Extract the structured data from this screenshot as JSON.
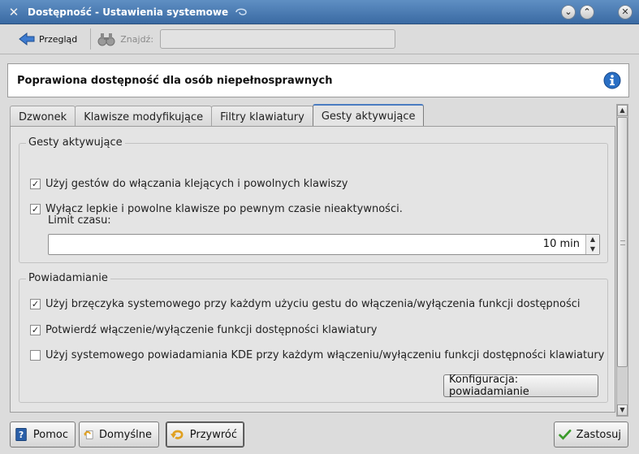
{
  "window": {
    "title": "Dostępność - Ustawienia systemowe",
    "icon": "tools-icon"
  },
  "toolbar": {
    "back_label": "Przegląd",
    "search_label": "Znajdź:",
    "search_value": ""
  },
  "header": {
    "title": "Poprawiona dostępność dla osób niepełnosprawnych"
  },
  "tabs": [
    {
      "label": "Dzwonek",
      "active": false
    },
    {
      "label": "Klawisze modyfikujące",
      "active": false
    },
    {
      "label": "Filtry klawiatury",
      "active": false
    },
    {
      "label": "Gesty aktywujące",
      "active": true
    }
  ],
  "gestures_group": {
    "title": "Gesty aktywujące",
    "option1": {
      "label": "Użyj gestów do włączania klejących i powolnych klawiszy",
      "checked": true
    },
    "option2": {
      "label": "Wyłącz lepkie i powolne klawisze po pewnym czasie nieaktywności.",
      "checked": true
    },
    "timeout_label": "Limit czasu:",
    "timeout_value": "10 min"
  },
  "notify_group": {
    "title": "Powiadamianie",
    "option1": {
      "label": "Użyj brzęczyka systemowego przy każdym użyciu gestu do włączenia/wyłączenia funkcji dostępności",
      "checked": true
    },
    "option2": {
      "label": "Potwierdź włączenie/wyłączenie funkcji dostępności klawiatury",
      "checked": true
    },
    "option3": {
      "label": "Użyj systemowego powiadamiania KDE przy każdym włączeniu/wyłączeniu funkcji dostępności klawiatury",
      "checked": false
    },
    "config_button": "Konfiguracja: powiadamianie"
  },
  "buttons": {
    "help": "Pomoc",
    "defaults": "Domyślne",
    "reset": "Przywróć",
    "apply": "Zastosuj"
  },
  "colors": {
    "titlebar": "#4a7cb5",
    "tab_accent": "#4a7cc1",
    "info_icon": "#2a6fc4",
    "apply_check": "#3a9a2a"
  }
}
